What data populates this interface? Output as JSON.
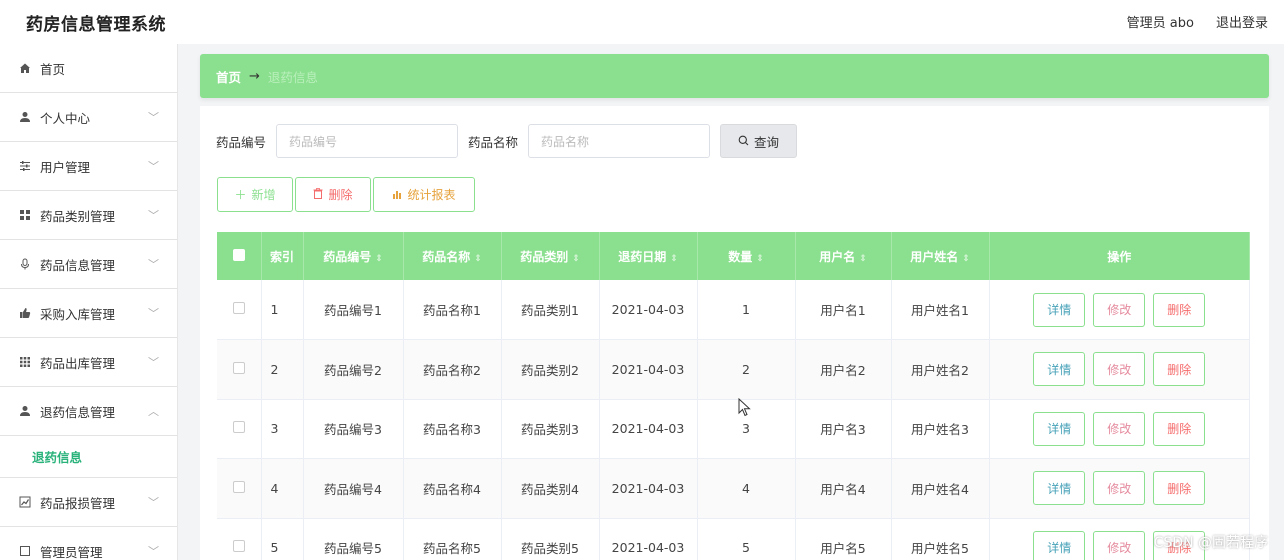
{
  "header": {
    "app_title": "药房信息管理系统",
    "user": "管理员 abo",
    "logout": "退出登录"
  },
  "sidebar": {
    "items": [
      {
        "label": "首页",
        "icon": "home-icon",
        "chevron": false
      },
      {
        "label": "个人中心",
        "icon": "user-icon",
        "chevron": true
      },
      {
        "label": "用户管理",
        "icon": "sliders-icon",
        "chevron": true
      },
      {
        "label": "药品类别管理",
        "icon": "grid-icon",
        "chevron": true
      },
      {
        "label": "药品信息管理",
        "icon": "mic-icon",
        "chevron": true
      },
      {
        "label": "采购入库管理",
        "icon": "thumb-icon",
        "chevron": true
      },
      {
        "label": "药品出库管理",
        "icon": "apps-icon",
        "chevron": true
      },
      {
        "label": "退药信息管理",
        "icon": "user-icon",
        "chevron": true,
        "expanded": true
      },
      {
        "label": "药品报损管理",
        "icon": "chart-icon",
        "chevron": true
      },
      {
        "label": "管理员管理",
        "icon": "square-icon",
        "chevron": true
      }
    ],
    "sub_item": "退药信息"
  },
  "breadcrumb": {
    "home": "首页",
    "arrow": "→",
    "current": "退药信息"
  },
  "search": {
    "code_label": "药品编号",
    "code_placeholder": "药品编号",
    "name_label": "药品名称",
    "name_placeholder": "药品名称",
    "button": "查询"
  },
  "actions": {
    "add": "新增",
    "delete": "删除",
    "report": "统计报表"
  },
  "table": {
    "columns": [
      "索引",
      "药品编号",
      "药品名称",
      "药品类别",
      "退药日期",
      "数量",
      "用户名",
      "用户姓名",
      "操作"
    ],
    "rows": [
      {
        "index": "1",
        "code": "药品编号1",
        "name": "药品名称1",
        "category": "药品类别1",
        "date": "2021-04-03",
        "qty": "1",
        "username": "用户名1",
        "realname": "用户姓名1"
      },
      {
        "index": "2",
        "code": "药品编号2",
        "name": "药品名称2",
        "category": "药品类别2",
        "date": "2021-04-03",
        "qty": "2",
        "username": "用户名2",
        "realname": "用户姓名2"
      },
      {
        "index": "3",
        "code": "药品编号3",
        "name": "药品名称3",
        "category": "药品类别3",
        "date": "2021-04-03",
        "qty": "3",
        "username": "用户名3",
        "realname": "用户姓名3"
      },
      {
        "index": "4",
        "code": "药品编号4",
        "name": "药品名称4",
        "category": "药品类别4",
        "date": "2021-04-03",
        "qty": "4",
        "username": "用户名4",
        "realname": "用户姓名4"
      },
      {
        "index": "5",
        "code": "药品编号5",
        "name": "药品名称5",
        "category": "药品类别5",
        "date": "2021-04-03",
        "qty": "5",
        "username": "用户名5",
        "realname": "用户姓名5"
      }
    ],
    "op_detail": "详情",
    "op_edit": "修改",
    "op_delete": "删除"
  },
  "watermark": "CSDN @固若程序",
  "colors": {
    "accent_green": "#8be08f",
    "danger_red": "#f56c6c",
    "warning_orange": "#e6a23c",
    "info_teal": "#47a2b8"
  }
}
